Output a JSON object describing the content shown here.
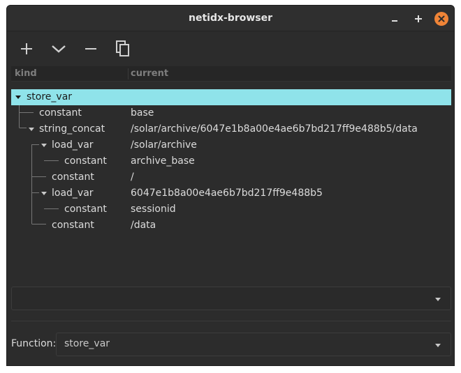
{
  "window": {
    "title": "netidx-browser"
  },
  "toolbar": {
    "add_icon": "plus-icon",
    "expand_icon": "chevron-down-icon",
    "remove_icon": "minus-icon",
    "duplicate_icon": "copy-icon"
  },
  "tree": {
    "columns": [
      "kind",
      "current"
    ],
    "rows": [
      {
        "kind": "store_var",
        "current": ""
      },
      {
        "kind": "constant",
        "current": "base"
      },
      {
        "kind": "string_concat",
        "current": "/solar/archive/6047e1b8a00e4ae6b7bd217ff9e488b5/data"
      },
      {
        "kind": "load_var",
        "current": "/solar/archive"
      },
      {
        "kind": "constant",
        "current": "archive_base"
      },
      {
        "kind": "constant",
        "current": "/"
      },
      {
        "kind": "load_var",
        "current": "6047e1b8a00e4ae6b7bd217ff9e488b5"
      },
      {
        "kind": "constant",
        "current": "sessionid"
      },
      {
        "kind": "constant",
        "current": "/data"
      }
    ]
  },
  "selector": {
    "value": ""
  },
  "function": {
    "label": "Function:",
    "value": "store_var"
  },
  "colors": {
    "selection": "#8fe3ea",
    "close_button": "#f08437",
    "background": "#2c2c2c"
  }
}
